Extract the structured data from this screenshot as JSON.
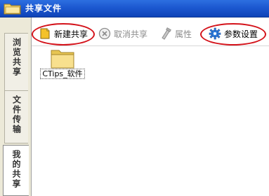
{
  "window": {
    "title": "共享文件",
    "icon": "folder-icon"
  },
  "left_tabs": [
    {
      "label": "浏览共享",
      "active": false
    },
    {
      "label": "文件传输",
      "active": false
    },
    {
      "label": "我的共享",
      "active": true
    }
  ],
  "toolbar": {
    "new_share_label": "新建共享",
    "cancel_share_label": "取消共享",
    "properties_label": "属性",
    "settings_label": "参数设置"
  },
  "files": [
    {
      "name": "CTips_软件",
      "icon": "folder-icon"
    }
  ],
  "colors": {
    "titlebar": "#1c58d0",
    "highlight_oval": "#d4121a",
    "folder": "#f6dd86"
  }
}
